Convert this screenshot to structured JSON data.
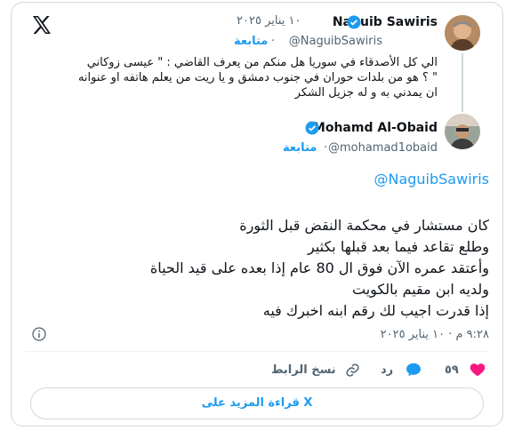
{
  "quoted": {
    "name": "Naguib Sawiris",
    "date": "١٠ يناير ٢٠٢٥",
    "handle": "@NaguibSawiris",
    "follow": "متابعة",
    "lines": [
      "الي كل الأصدقاء في سوريا هل منكم من يعرف القاضي : \" عيسى زوكاني",
      "\" ؟ هو من بلدات حوران في جنوب دمشق و يا ريت من يعلم هاتفه او عنوانه",
      "ان يمدني به و له جزيل الشكر"
    ]
  },
  "reply": {
    "name": "Mohamd Al-Obaid",
    "handle": "@mohamad1obaid",
    "follow": "متابعة",
    "mention": "@NaguibSawiris",
    "lines": [
      "كان مستشار في محكمة النقض قبل الثورة",
      "وطلع تقاعد فيما بعد قبلها بكثير",
      "وأعتقد عمره الآن فوق ال 80 عام إذا  بعده على قيد الحياة",
      "ولديه ابن مقيم بالكويت",
      "إذا قدرت اجيب لك رقم ابنه اخبرك فيه"
    ],
    "timestamp": "٩:٢٨ م · ١٠ يناير ٢٠٢٥"
  },
  "actions": {
    "likes": "٥٩",
    "reply_label": "رد",
    "copy_label": "نسخ الرابط"
  },
  "read_more": "قراءة المزيد على X",
  "colors": {
    "accent": "#1d9bf0",
    "like": "#f91880",
    "muted": "#536471",
    "border": "#cfd9de"
  },
  "icons": [
    "x-logo-icon",
    "verified-badge-icon",
    "info-icon",
    "heart-icon",
    "reply-icon",
    "link-icon"
  ]
}
